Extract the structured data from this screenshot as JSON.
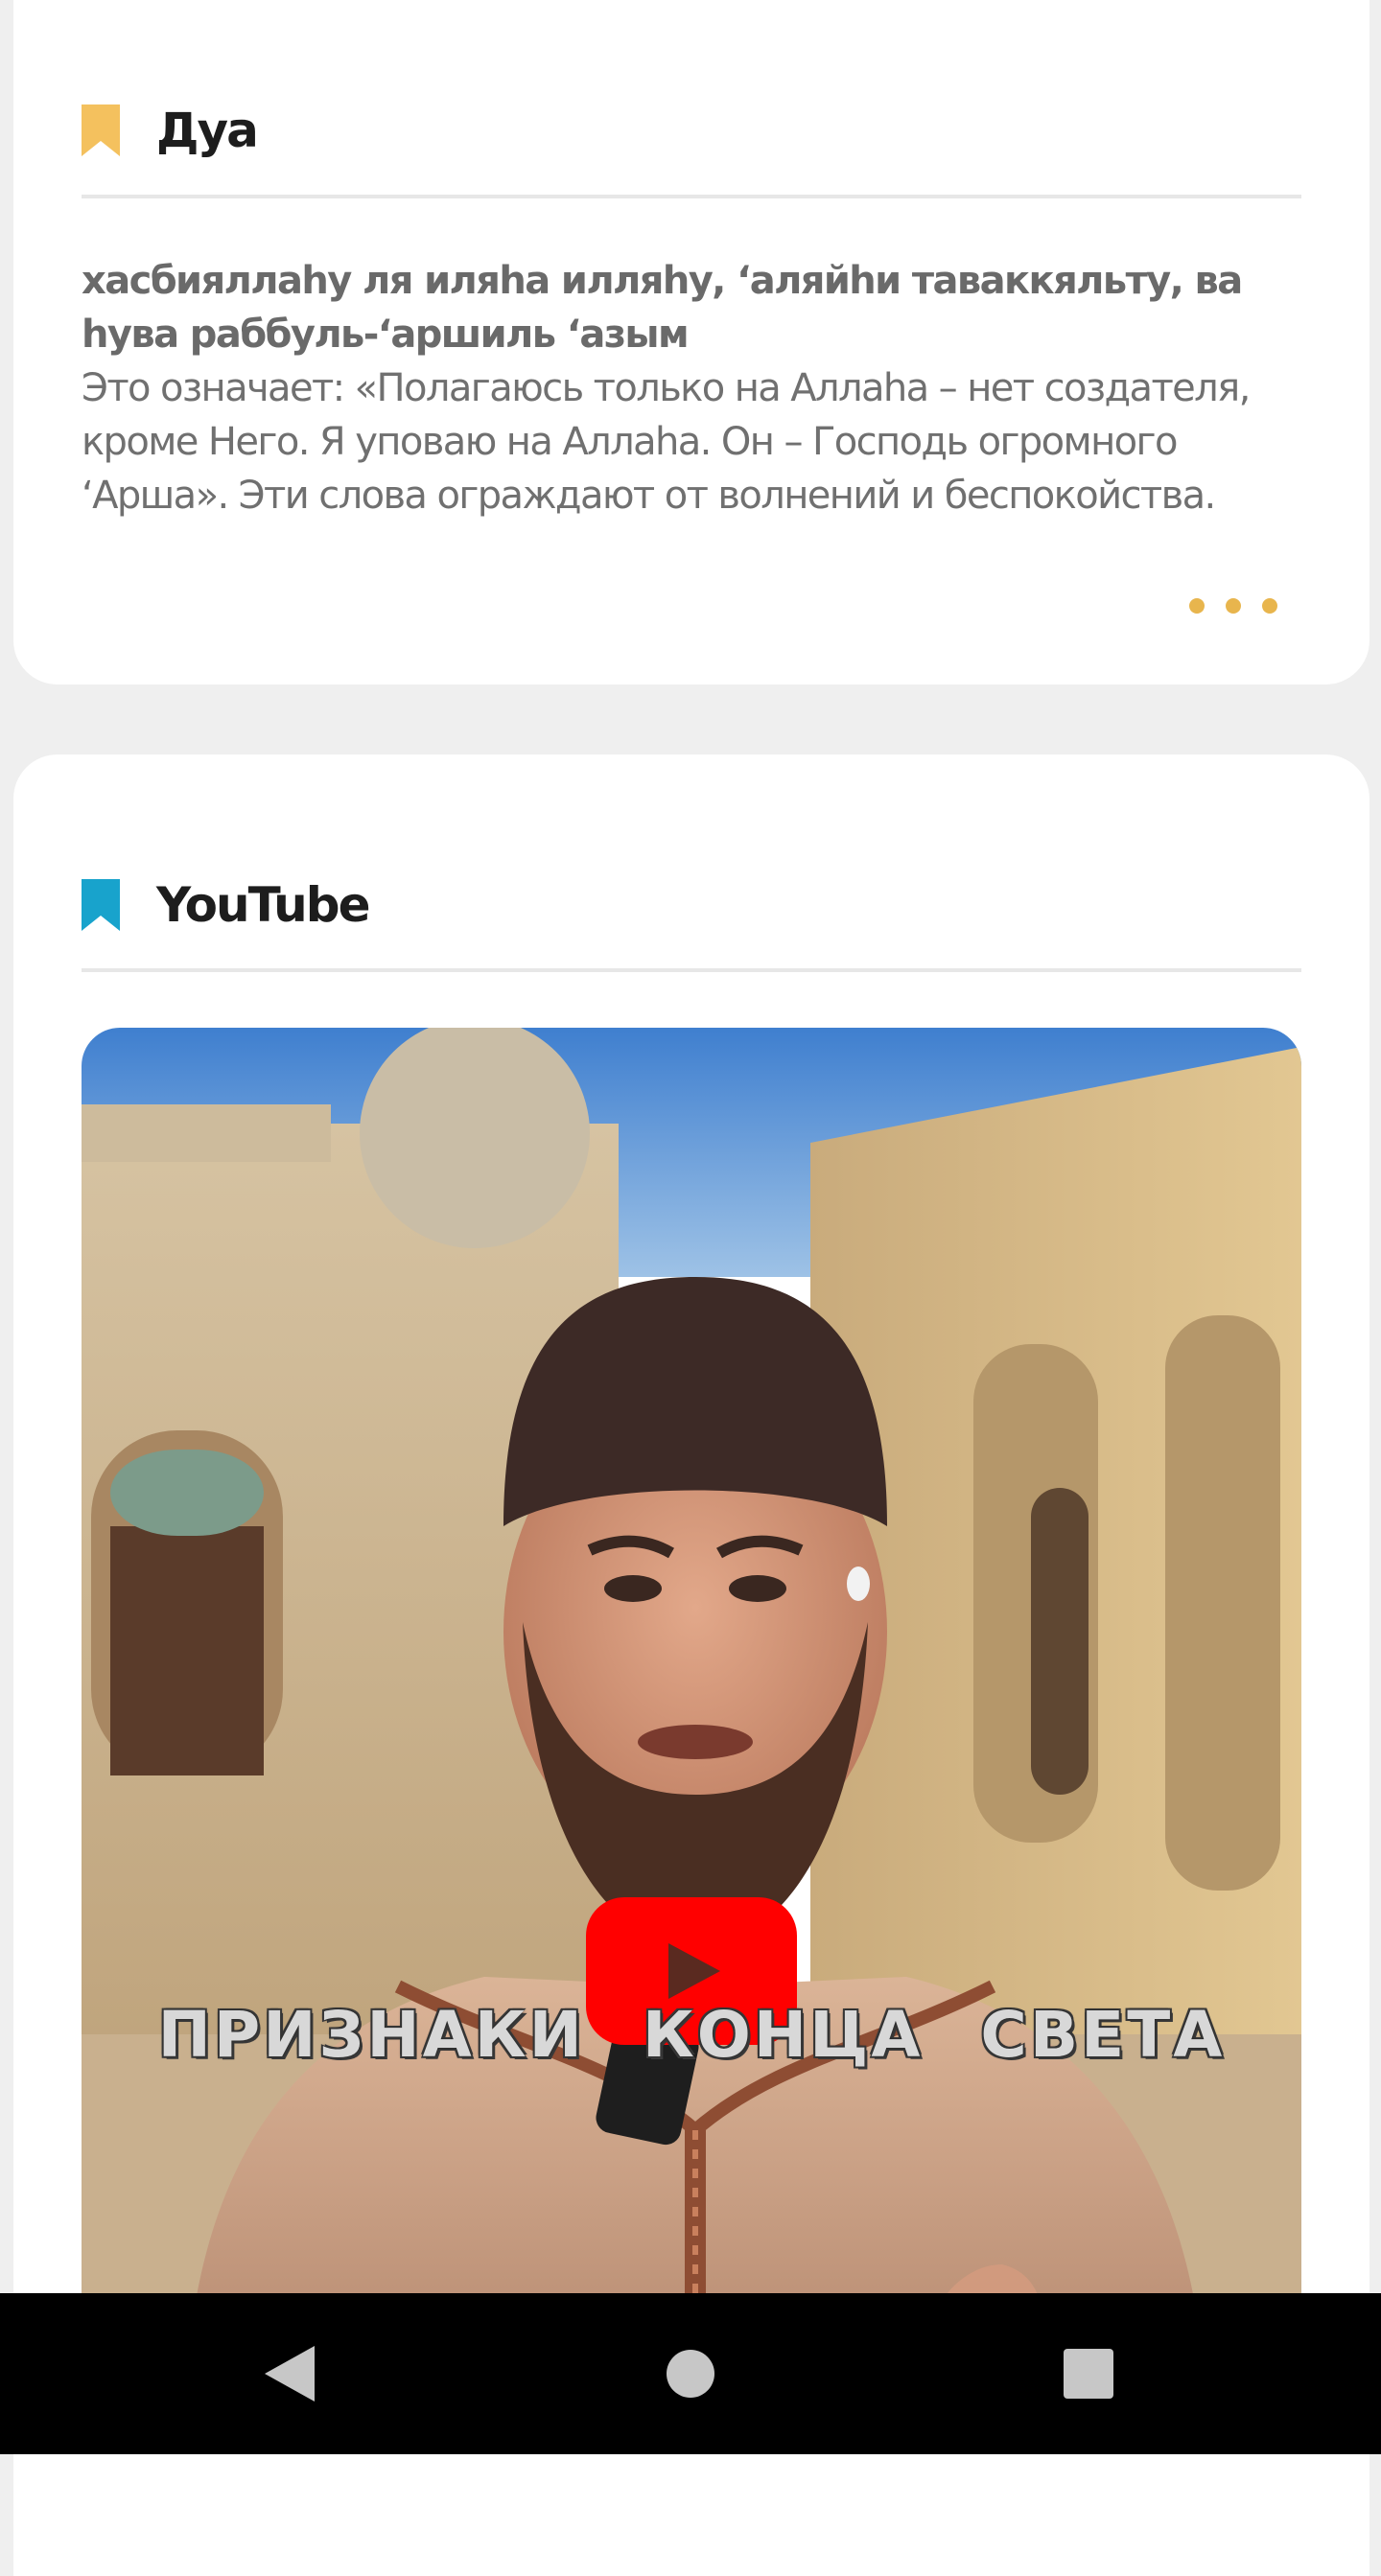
{
  "dua_card": {
    "title": "Дуа",
    "bookmark_color": "#f4c15e",
    "arabic_transliteration": "хасбияллаhу ля иляhа илляhу, ‘аляйhи таваккяльту, ва hува раббуль-‘аршиль ‘азым",
    "meaning": "Это означает: «Полагаюсь только на Аллаhа – нет создателя, кроме Него. Я уповаю на Аллаhа. Он – Господь огромного ‘Арша». Эти слова ограждают от волнений и беспокойства.",
    "more_icon": "more-horizontal-dots-icon",
    "accent_color": "#e8b54d"
  },
  "youtube_card": {
    "title": "YouTube",
    "bookmark_color": "#18a3cc",
    "video": {
      "caption": "ПРИЗНАКИ КОНЦА СВЕТА",
      "play_icon": "youtube-play-icon",
      "play_color": "#ff0000"
    }
  },
  "nav_bar": {
    "back_icon": "back-triangle-icon",
    "home_icon": "home-circle-icon",
    "recents_icon": "recents-square-icon"
  }
}
